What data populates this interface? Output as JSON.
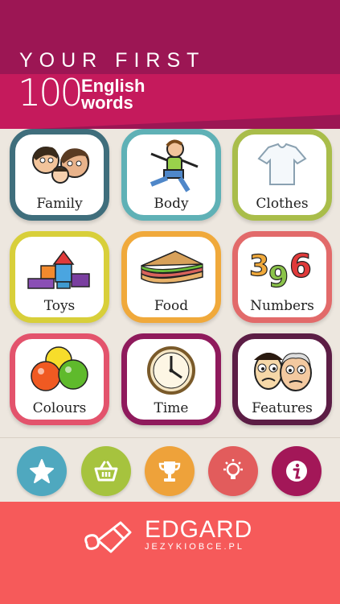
{
  "header": {
    "line1": "YOUR FIRST",
    "number": "100",
    "line2a": "English",
    "line2b": "words"
  },
  "tiles": [
    {
      "label": "Family",
      "color": "#3f6e7c"
    },
    {
      "label": "Body",
      "color": "#5fb1b6"
    },
    {
      "label": "Clothes",
      "color": "#a9bd4a"
    },
    {
      "label": "Toys",
      "color": "#d8cf3a"
    },
    {
      "label": "Food",
      "color": "#f0a93b"
    },
    {
      "label": "Numbers",
      "color": "#e26a6a"
    },
    {
      "label": "Colours",
      "color": "#e3536c"
    },
    {
      "label": "Time",
      "color": "#8f1a5c"
    },
    {
      "label": "Features",
      "color": "#5c1d45"
    }
  ],
  "bottom_buttons": [
    {
      "icon": "star-icon",
      "color": "#4fa8bf"
    },
    {
      "icon": "basket-icon",
      "color": "#a6c33e"
    },
    {
      "icon": "trophy-icon",
      "color": "#eea23a"
    },
    {
      "icon": "lightbulb-icon",
      "color": "#e25c5c"
    },
    {
      "icon": "info-icon",
      "color": "#a31758"
    }
  ],
  "footer": {
    "brand": "EDGARD",
    "sub": "JEZYKIOBCE.PL"
  }
}
